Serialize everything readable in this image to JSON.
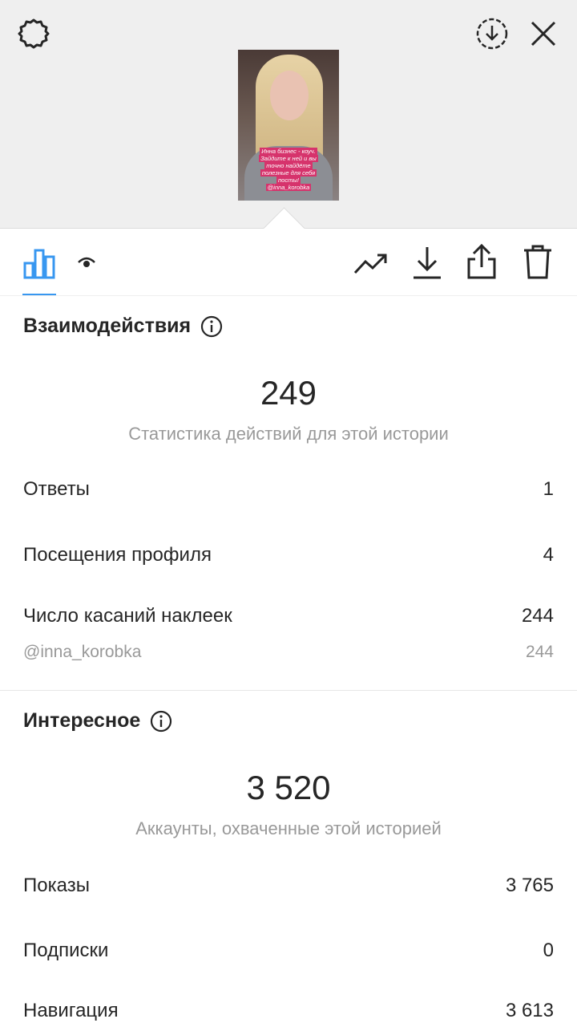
{
  "story": {
    "caption_lines": [
      "Инна бизнес - коуч.",
      "Зайдите к ней и вы",
      "точно найдёте",
      "полезные для себя",
      "посты!",
      "@inna_korobka"
    ]
  },
  "toolbar": {
    "icons": [
      "bar-chart-icon",
      "eye-icon",
      "trending-icon",
      "download-icon",
      "share-icon",
      "trash-icon"
    ],
    "accent": "#3897f0"
  },
  "interactions": {
    "title": "Взаимодействия",
    "total": "249",
    "total_label": "Статистика действий для этой истории",
    "rows": [
      {
        "label": "Ответы",
        "value": "1"
      },
      {
        "label": "Посещения профиля",
        "value": "4"
      },
      {
        "label": "Число касаний наклеек",
        "value": "244"
      }
    ],
    "sticker": {
      "label": "@inna_korobka",
      "value": "244"
    }
  },
  "discovery": {
    "title": "Интересное",
    "total": "3 520",
    "total_label": "Аккаунты, охваченные этой историей",
    "rows": [
      {
        "label": "Показы",
        "value": "3 765"
      },
      {
        "label": "Подписки",
        "value": "0"
      },
      {
        "label": "Навигация",
        "value": "3 613"
      }
    ]
  }
}
